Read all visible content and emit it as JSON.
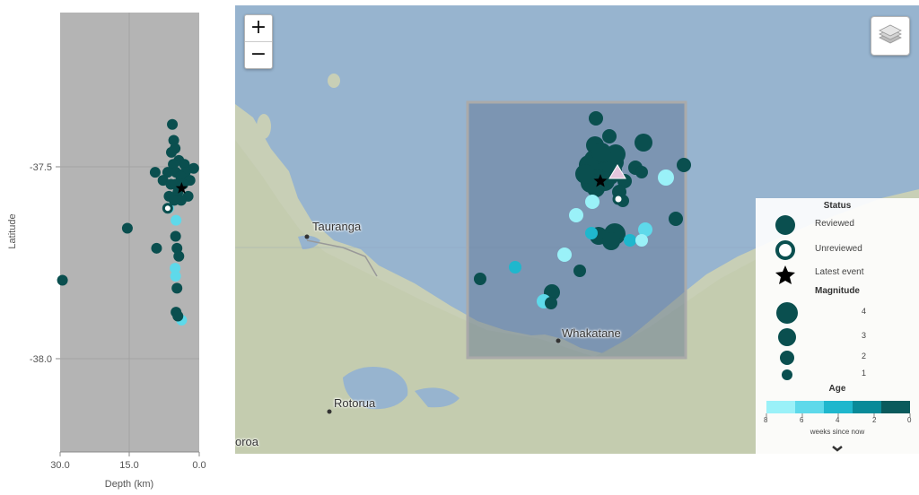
{
  "depth_chart": {
    "xlabel": "Depth (km)",
    "ylabel": "Latitude",
    "x_ticks": [
      "30.0",
      "15.0",
      "0.0"
    ],
    "y_ticks": [
      "-37.5",
      "-38.0"
    ],
    "xlim": [
      30,
      0
    ],
    "ylim": [
      -38.2,
      -37.1
    ]
  },
  "chart_data": {
    "type": "scatter",
    "xlabel": "Depth (km)",
    "ylabel": "Latitude",
    "xlim": [
      30,
      0
    ],
    "ylim": [
      -38.2,
      -37.1
    ],
    "series": [
      {
        "points": [
          [
            5.8,
            -37.38
          ],
          [
            5.5,
            -37.42
          ],
          [
            5.2,
            -37.44
          ],
          [
            6.0,
            -37.45
          ],
          [
            4.4,
            -37.47
          ],
          [
            5.6,
            -37.48
          ],
          [
            3.2,
            -37.48
          ],
          [
            1.2,
            -37.49
          ],
          [
            6.8,
            -37.5
          ],
          [
            9.5,
            -37.5
          ],
          [
            5.0,
            -37.5
          ],
          [
            3.0,
            -37.5
          ],
          [
            4.0,
            -37.51
          ],
          [
            7.8,
            -37.52
          ],
          [
            2.0,
            -37.52
          ],
          [
            6.1,
            -37.53
          ],
          [
            5.1,
            -37.53
          ],
          [
            3.5,
            -37.53
          ],
          [
            4.6,
            -37.55
          ],
          [
            2.4,
            -37.56
          ],
          [
            6.5,
            -37.56
          ],
          [
            5.4,
            -37.57
          ],
          [
            3.9,
            -37.57
          ],
          [
            15.5,
            -37.64
          ],
          [
            9.2,
            -37.69
          ],
          [
            5.1,
            -37.66
          ],
          [
            4.8,
            -37.69
          ],
          [
            4.4,
            -37.71
          ],
          [
            5.0,
            -37.85
          ],
          [
            4.6,
            -37.86
          ],
          [
            29.5,
            -37.77
          ],
          [
            4.8,
            -37.79
          ]
        ],
        "age_weeks": 0
      },
      {
        "points": [
          [
            6.6,
            -37.59
          ],
          [
            5.0,
            -37.62
          ],
          [
            5.2,
            -37.74
          ],
          [
            5.1,
            -37.76
          ],
          [
            3.8,
            -37.87
          ]
        ],
        "age_weeks": 6
      }
    ],
    "latest_event": [
      3.8,
      -37.54
    ]
  },
  "map": {
    "zoom_in": "+",
    "zoom_out": "−",
    "layers_icon": "layers-icon",
    "places": [
      "Tauranga",
      "Whakatane",
      "Rotorua",
      "oroa"
    ],
    "land_color": "#c8cfb6",
    "sea_color": "#97b4cf"
  },
  "legend": {
    "status_title": "Status",
    "reviewed": "Reviewed",
    "unreviewed": "Unreviewed",
    "latest": "Latest event",
    "magnitude_title": "Magnitude",
    "magnitudes": [
      "4",
      "3",
      "2",
      "1"
    ],
    "age_title": "Age",
    "age_ticks": [
      "8",
      "6",
      "4",
      "2",
      "0"
    ],
    "age_caption": "weeks since now",
    "age_colors": [
      "#9af1f8",
      "#5ed9ea",
      "#1fb7cd",
      "#098a98",
      "#0a5a5c"
    ],
    "marker_color": "#0a4f4f"
  }
}
